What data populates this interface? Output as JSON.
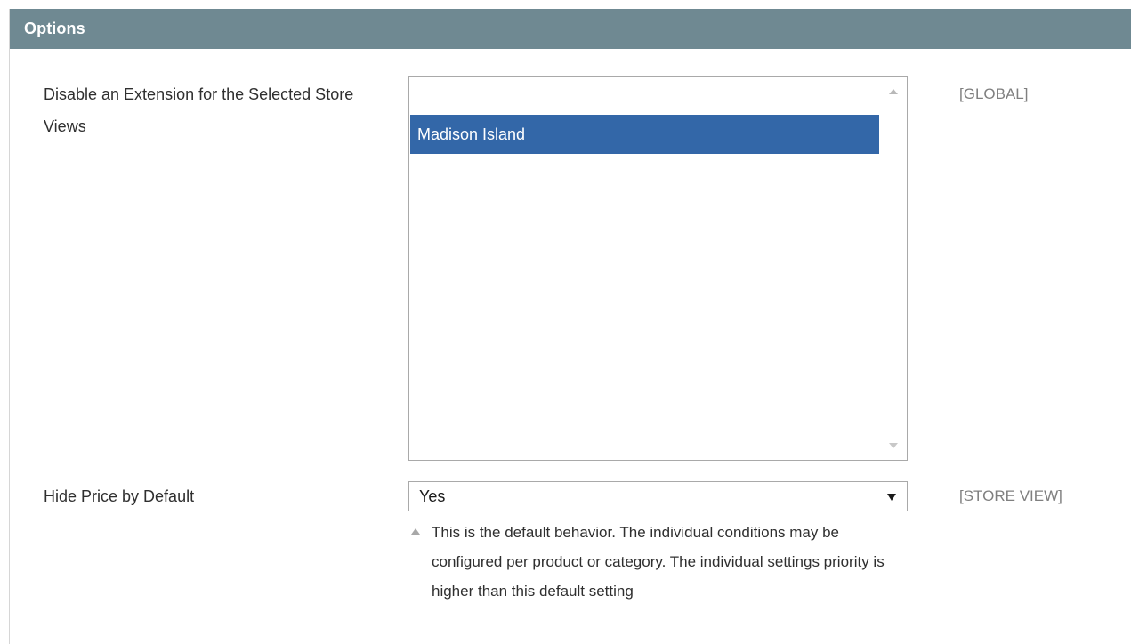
{
  "section": {
    "title": "Options"
  },
  "rows": [
    {
      "label": "Disable an Extension for the Selected Store Views",
      "scope": "[GLOBAL]",
      "multiselect": {
        "options": [
          "Madison Island"
        ],
        "selected": "Madison Island"
      }
    },
    {
      "label": "Hide Price by Default",
      "scope": "[STORE VIEW]",
      "select": {
        "value": "Yes"
      },
      "note": "This is the default behavior. The individual conditions may be configured per product or category. The individual settings priority is higher than this default setting"
    }
  ],
  "icons": {
    "scroll_up": "scroll-up-arrow-icon",
    "scroll_down": "scroll-down-arrow-icon",
    "dropdown": "dropdown-arrow-icon",
    "note": "note-triangle-icon"
  },
  "colors": {
    "header_bg": "#6f8992",
    "selected_option_bg": "#3367a8",
    "scope_text": "#7f7f7f"
  }
}
